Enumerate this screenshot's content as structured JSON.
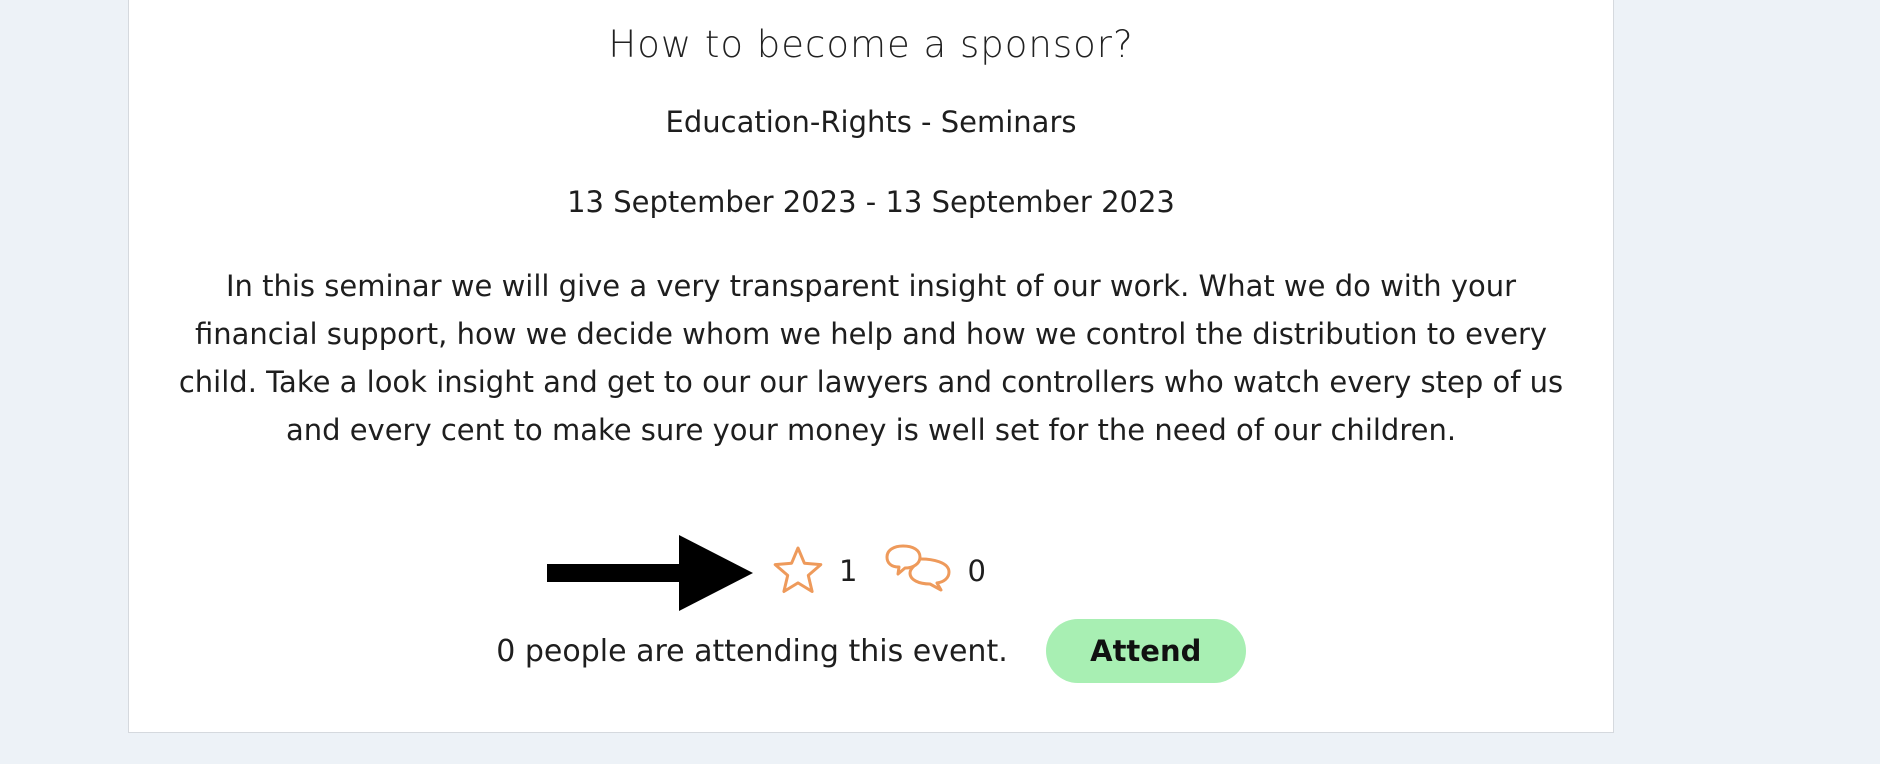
{
  "event": {
    "title": "How to become a sponsor?",
    "category": "Education-Rights - Seminars",
    "dates": "13 September 2023 - 13 September 2023",
    "description": "In this seminar we will give a very transparent insight of our work. What we do with your financial support, how we decide whom we help and how we control the distribution to every child. Take a look insight and get to our our lawyers and controllers who watch every step of us and every cent to make sure your money is well set for the need of our children."
  },
  "stats": {
    "favorites_icon": "star-icon",
    "favorites_count": "1",
    "comments_icon": "comments-icon",
    "comments_count": "0"
  },
  "attendance": {
    "text": "0 people are attending this event.",
    "button_label": "Attend"
  },
  "annotation": {
    "icon": "arrow-right-icon"
  },
  "colors": {
    "background": "#edf2f7",
    "card": "#ffffff",
    "icon_accent": "#ee9a5b",
    "attend_button": "#a8efb3",
    "arrow": "#000000"
  }
}
